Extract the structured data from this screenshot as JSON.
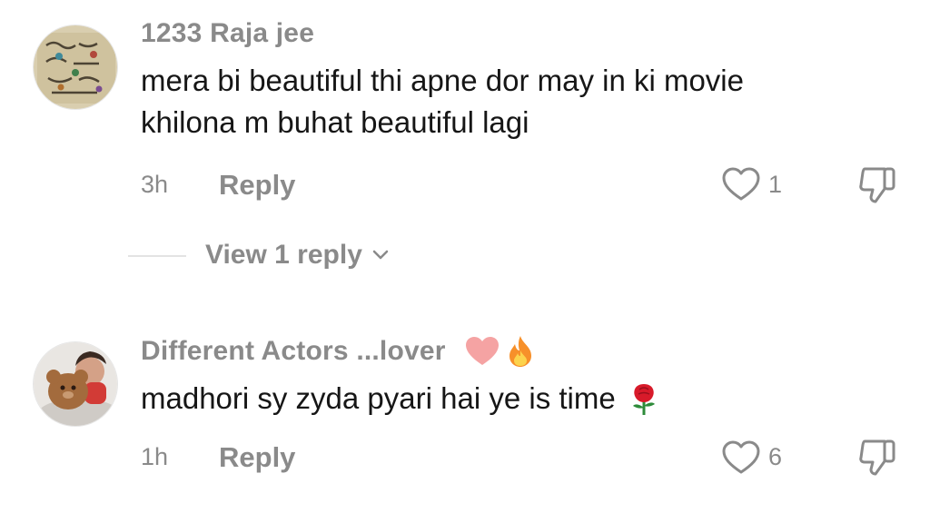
{
  "comments": [
    {
      "username": "1233 Raja jee",
      "text_lines": [
        "mera bi beautiful thi apne dor may in ki movie",
        "khilona m buhat beautiful lagi"
      ],
      "time": "3h",
      "reply_label": "Reply",
      "like_count": "1",
      "view_replies_label": "View 1 reply",
      "avatar_icon": "calligraphy-avatar"
    },
    {
      "username": "Different Actors ...lover",
      "username_emojis": [
        "pink-heart",
        "fire"
      ],
      "text": "madhori sy zyda pyari hai ye is time",
      "text_emoji": "rose",
      "time": "1h",
      "reply_label": "Reply",
      "like_count": "6",
      "avatar_icon": "child-with-teddy-avatar"
    }
  ],
  "colors": {
    "muted": "#8a8a8a",
    "text": "#161616",
    "divider": "#e3e3e3",
    "heart_emoji": "#f5a3a3",
    "fire_emoji": "#f7902a",
    "rose_emoji": "#d81a2a"
  }
}
